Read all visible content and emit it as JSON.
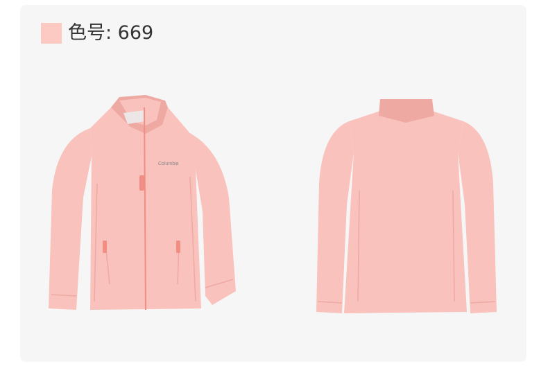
{
  "color_label": "色号: 669",
  "colors": {
    "swatch": "#fcc9c3",
    "jacket": "#f9c2bd",
    "jacket_shadow": "#eea9a3",
    "zipper": "#f28d83",
    "card": "#f6f6f6"
  },
  "front_view": {
    "brand_logo_text": "Columbia"
  }
}
